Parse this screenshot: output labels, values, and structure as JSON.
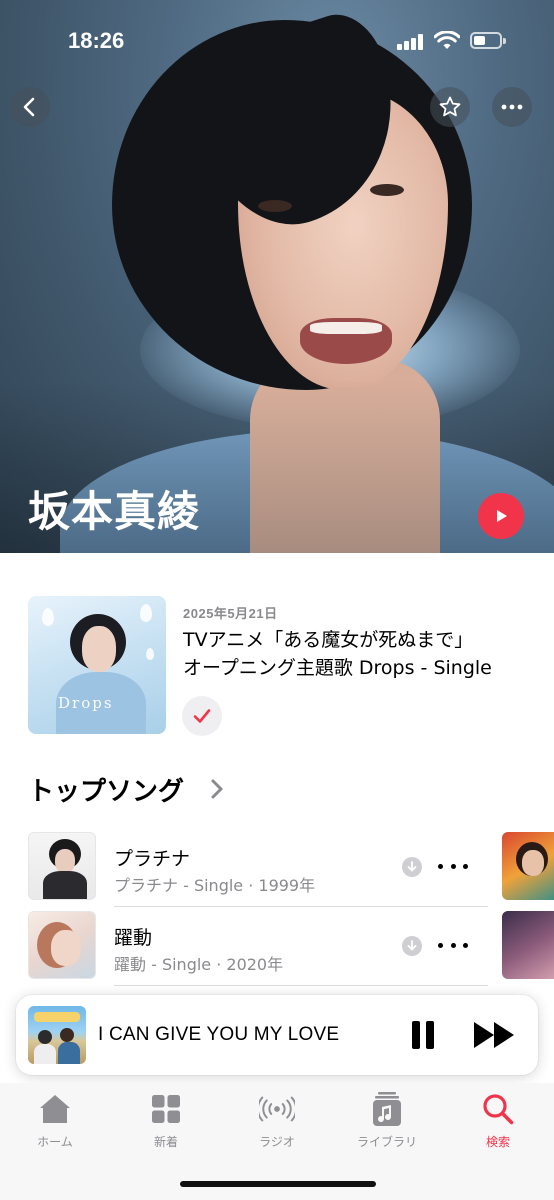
{
  "status_bar": {
    "time": "18:26"
  },
  "artist": {
    "name": "坂本真綾"
  },
  "latest_release": {
    "date": "2025年5月21日",
    "title": "TVアニメ「ある魔女が死ぬまで」\nオープニング主題歌 Drops - Single",
    "artwork_text": "Drops"
  },
  "top_songs": {
    "heading": "トップソング",
    "songs": [
      {
        "title": "プラチナ",
        "subtitle": "プラチナ - Single · 1999年"
      },
      {
        "title": "躍動",
        "subtitle": "躍動 - Single · 2020年"
      }
    ]
  },
  "now_playing": {
    "title": "I CAN GIVE YOU MY LOVE"
  },
  "tab_bar": {
    "tabs": [
      {
        "label": "ホーム",
        "icon": "house-icon"
      },
      {
        "label": "新着",
        "icon": "grid-icon"
      },
      {
        "label": "ラジオ",
        "icon": "radio-waves-icon"
      },
      {
        "label": "ライブラリ",
        "icon": "music-library-icon"
      },
      {
        "label": "検索",
        "icon": "search-icon"
      }
    ],
    "active": "検索"
  },
  "colors": {
    "accent": "#f2344b",
    "secondary_text": "#8a8a8e",
    "tab_inactive": "#8e8e93"
  }
}
